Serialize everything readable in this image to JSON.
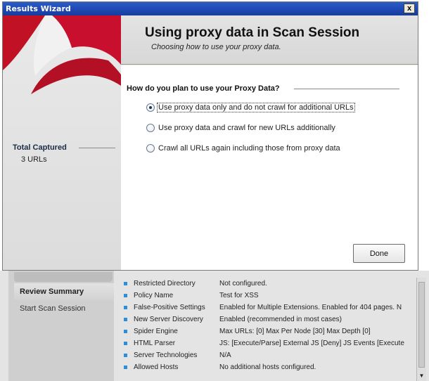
{
  "dialog": {
    "title": "Results Wizard",
    "close_label": "x",
    "header_title": "Using proxy data in Scan Session",
    "header_subtitle": "Choosing how to use your proxy data.",
    "total_captured_label": "Total Captured",
    "total_captured_value": "3 URLs",
    "question": "How do you plan to use your Proxy Data?",
    "options": [
      {
        "label": "Use proxy data only and do not crawl for additional URLs",
        "selected": true
      },
      {
        "label": "Use proxy data and crawl for new URLs additionally",
        "selected": false
      },
      {
        "label": "Crawl all URLs again including those from proxy data",
        "selected": false
      }
    ],
    "done_label": "Done",
    "colors": {
      "title_bar": "#1e47b0",
      "logo_red": "#c8102e"
    }
  },
  "background": {
    "nav": [
      "Review Summary",
      "Start Scan Session"
    ],
    "summary_rows": [
      {
        "key": "Restricted Directory",
        "value": "Not configured."
      },
      {
        "key": "Policy Name",
        "value": "Test for XSS"
      },
      {
        "key": "False-Positive Settings",
        "value": "Enabled for Multiple Extensions. Enabled for 404 pages. N"
      },
      {
        "key": "New Server Discovery",
        "value": "Enabled (recommended in most cases)"
      },
      {
        "key": "Spider Engine",
        "value": "Max URLs: [0] Max Per Node [30] Max Depth [0]"
      },
      {
        "key": "HTML Parser",
        "value": "JS: [Execute/Parse] External JS [Deny] JS Events [Execute"
      },
      {
        "key": "Server Technologies",
        "value": "N/A"
      },
      {
        "key": "Allowed Hosts",
        "value": "No additional hosts configured."
      }
    ],
    "scroll_down_icon": "arrow-down-icon",
    "bullet_color": "#2a8fd8"
  }
}
